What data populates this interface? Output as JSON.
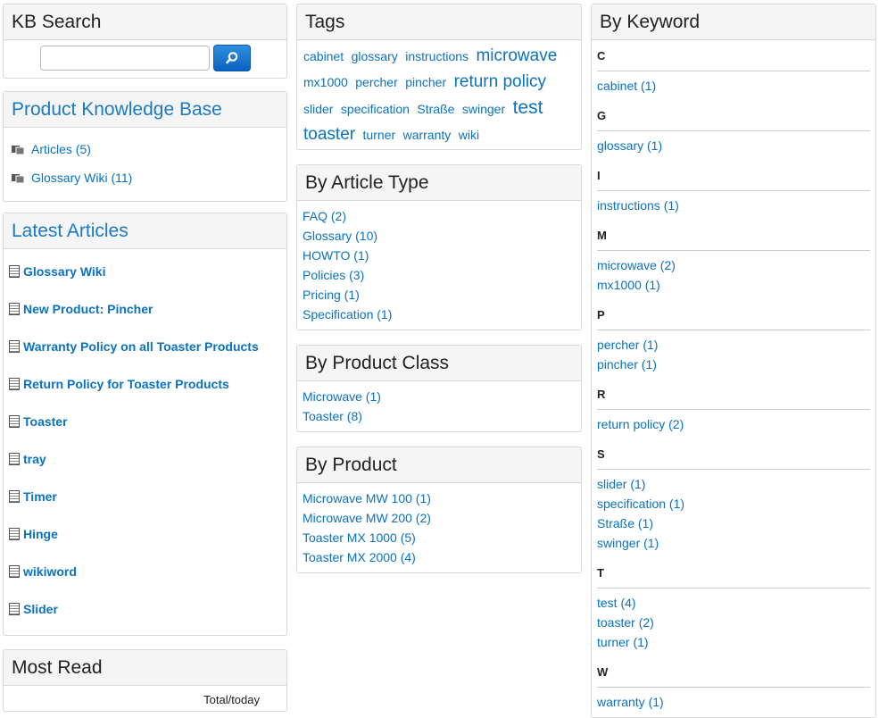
{
  "kb_search": {
    "title": "KB Search",
    "input_value": "",
    "input_placeholder": ""
  },
  "product_kb": {
    "title": "Product Knowledge Base",
    "items": [
      {
        "label": "Articles (5)"
      },
      {
        "label": "Glossary Wiki (11)"
      }
    ]
  },
  "latest_articles": {
    "title": "Latest Articles",
    "items": [
      "Glossary Wiki",
      "New Product: Pincher",
      "Warranty Policy on all Toaster Products",
      "Return Policy for Toaster Products",
      "Toaster",
      "tray",
      "Timer",
      "Hinge",
      "wikiword",
      "Slider"
    ]
  },
  "most_read": {
    "title": "Most Read",
    "column_label": "Total/today"
  },
  "tags": {
    "title": "Tags",
    "items": [
      {
        "label": "cabinet",
        "size": 14
      },
      {
        "label": "glossary",
        "size": 14
      },
      {
        "label": "instructions",
        "size": 14
      },
      {
        "label": "microwave",
        "size": 19
      },
      {
        "label": "mx1000",
        "size": 14
      },
      {
        "label": "percher",
        "size": 14
      },
      {
        "label": "pincher",
        "size": 14
      },
      {
        "label": "return policy",
        "size": 19
      },
      {
        "label": "slider",
        "size": 14
      },
      {
        "label": "specification",
        "size": 14
      },
      {
        "label": "Straße",
        "size": 14
      },
      {
        "label": "swinger",
        "size": 14
      },
      {
        "label": "test",
        "size": 21
      },
      {
        "label": "toaster",
        "size": 19
      },
      {
        "label": "turner",
        "size": 14
      },
      {
        "label": "warranty",
        "size": 14
      },
      {
        "label": "wiki",
        "size": 14
      }
    ]
  },
  "article_type": {
    "title": "By Article Type",
    "items": [
      "FAQ (2)",
      "Glossary (10)",
      "HOWTO (1)",
      "Policies (3)",
      "Pricing (1)",
      "Specification (1)"
    ]
  },
  "product_class": {
    "title": "By Product Class",
    "items": [
      "Microwave (1)",
      "Toaster (8)"
    ]
  },
  "product": {
    "title": "By Product",
    "items": [
      "Microwave MW 100 (1)",
      "Microwave MW 200 (2)",
      "Toaster MX 1000 (5)",
      "Toaster MX 2000 (4)"
    ]
  },
  "keyword": {
    "title": "By Keyword",
    "groups": [
      {
        "letter": "C",
        "items": [
          "cabinet (1)"
        ]
      },
      {
        "letter": "G",
        "items": [
          "glossary (1)"
        ]
      },
      {
        "letter": "I",
        "items": [
          "instructions (1)"
        ]
      },
      {
        "letter": "M",
        "items": [
          "microwave (2)",
          "mx1000 (1)"
        ]
      },
      {
        "letter": "P",
        "items": [
          "percher (1)",
          "pincher (1)"
        ]
      },
      {
        "letter": "R",
        "items": [
          "return policy (2)"
        ]
      },
      {
        "letter": "S",
        "items": [
          "slider (1)",
          "specification (1)",
          "Straße (1)",
          "swinger (1)"
        ]
      },
      {
        "letter": "T",
        "items": [
          "test (4)",
          "toaster (2)",
          "turner (1)"
        ]
      },
      {
        "letter": "W",
        "items": [
          "warranty (1)"
        ]
      }
    ]
  },
  "colors": {
    "link": "#0a72c0",
    "panel_header_bg": "#f5f5f5",
    "search_button": "#1a73d0"
  },
  "icons": {
    "search_button": "search-icon",
    "kb_item": "folder-icon",
    "article_item": "document-icon"
  }
}
